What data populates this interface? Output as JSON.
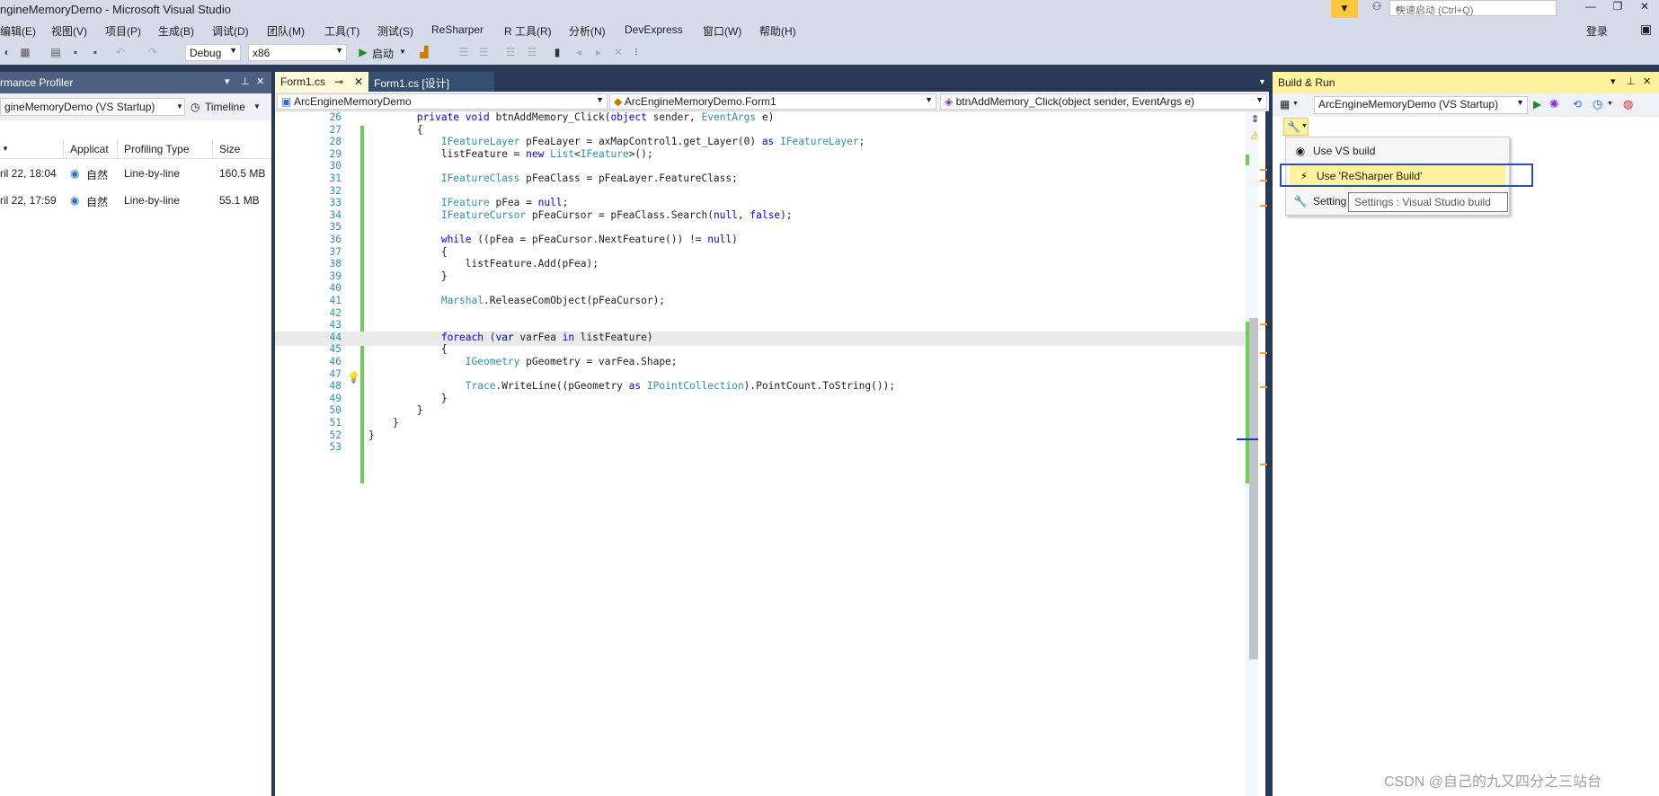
{
  "window": {
    "title": "ngineMemoryDemo - Microsoft Visual Studio",
    "quick_launch_placeholder": "快速启动 (Ctrl+Q)",
    "login": "登录"
  },
  "menu": [
    "编辑(E)",
    "视图(V)",
    "项目(P)",
    "生成(B)",
    "调试(D)",
    "团队(M)",
    "工具(T)",
    "测试(S)",
    "ReSharper",
    "R 工具(R)",
    "分析(N)",
    "DevExpress",
    "窗口(W)",
    "帮助(H)"
  ],
  "toolbar": {
    "config": "Debug",
    "platform": "x86",
    "start": "启动"
  },
  "profiler": {
    "header": "rmance Profiler",
    "startup": "gineMemoryDemo (VS Startup)",
    "timeline": "Timeline",
    "columns": [
      "Applicat",
      "Profiling Type",
      "Size"
    ],
    "rows": [
      {
        "date": "ril 22, 18:04",
        "app": "自然",
        "type": "Line-by-line",
        "size": "160.5 MB"
      },
      {
        "date": "ril 22, 17:59",
        "app": "自然",
        "type": "Line-by-line",
        "size": "55.1 MB"
      }
    ]
  },
  "editor": {
    "tabs": [
      {
        "label": "Form1.cs"
      },
      {
        "label": "Form1.cs [设计]"
      }
    ],
    "nav": {
      "project": "ArcEngineMemoryDemo",
      "class": "ArcEngineMemoryDemo.Form1",
      "member": "btnAddMemory_Click(object sender, EventArgs e)"
    },
    "lines": [
      {
        "n": "26",
        "code": "        private void btnAddMemory_Click(object sender, EventArgs e)"
      },
      {
        "n": "27",
        "code": "        {"
      },
      {
        "n": "28",
        "code": "            IFeatureLayer pFeaLayer = axMapControl1.get_Layer(0) as IFeatureLayer;"
      },
      {
        "n": "29",
        "code": "            listFeature = new List<IFeature>();"
      },
      {
        "n": "30",
        "code": ""
      },
      {
        "n": "31",
        "code": "            IFeatureClass pFeaClass = pFeaLayer.FeatureClass;"
      },
      {
        "n": "32",
        "code": ""
      },
      {
        "n": "33",
        "code": "            IFeature pFea = null;"
      },
      {
        "n": "34",
        "code": "            IFeatureCursor pFeaCursor = pFeaClass.Search(null, false);"
      },
      {
        "n": "35",
        "code": ""
      },
      {
        "n": "36",
        "code": "            while ((pFea = pFeaCursor.NextFeature()) != null)"
      },
      {
        "n": "37",
        "code": "            {"
      },
      {
        "n": "38",
        "code": "                listFeature.Add(pFea);"
      },
      {
        "n": "39",
        "code": "            }"
      },
      {
        "n": "40",
        "code": ""
      },
      {
        "n": "41",
        "code": "            Marshal.ReleaseComObject(pFeaCursor);"
      },
      {
        "n": "42",
        "code": ""
      },
      {
        "n": "43",
        "code": ""
      },
      {
        "n": "44",
        "code": "            foreach (var varFea in listFeature)"
      },
      {
        "n": "45",
        "code": "            {"
      },
      {
        "n": "46",
        "code": "                IGeometry pGeometry = varFea.Shape;"
      },
      {
        "n": "47",
        "code": ""
      },
      {
        "n": "48",
        "code": "                Trace.WriteLine((pGeometry as IPointCollection).PointCount.ToString());"
      },
      {
        "n": "49",
        "code": "            }"
      },
      {
        "n": "50",
        "code": "        }"
      },
      {
        "n": "51",
        "code": "    }"
      },
      {
        "n": "52",
        "code": "}"
      },
      {
        "n": "53",
        "code": ""
      }
    ]
  },
  "build_run": {
    "header": "Build & Run",
    "project": "ArcEngineMemoryDemo (VS Startup)",
    "menu": [
      {
        "label": "Use VS build"
      },
      {
        "label": "Use 'ReSharper Build'"
      },
      {
        "label": "Setting"
      }
    ],
    "tooltip": "Settings : Visual Studio build"
  },
  "watermark": "CSDN @自己的九又四分之三站台",
  "colors": {
    "chrome": "#d6dbe9",
    "dark": "#293955",
    "highlight": "#fff29d",
    "selection_border": "#2a4fb5",
    "change_marker": "#6ccd5b"
  }
}
